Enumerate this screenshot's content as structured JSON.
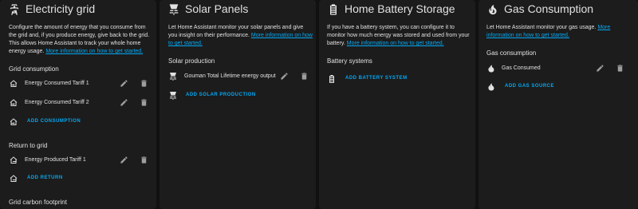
{
  "colors": {
    "accent": "#03a9f4",
    "card_bg": "#1c1c1c",
    "page_bg": "#111111",
    "text": "#e1e1e1"
  },
  "grid": {
    "title": "Electricity grid",
    "icon": "transmission-tower-icon",
    "desc": "Configure the amount of energy that you consume from the grid and, if you produce energy, give back to the grid. This allows Home Assistant to track your whole home energy usage.",
    "link": "More information on how to get started.",
    "consumption_title": "Grid consumption",
    "consumption": [
      {
        "label": "Energy Consumed Tariff 1"
      },
      {
        "label": "Energy Consumed Tariff 2"
      }
    ],
    "add_consumption": "ADD CONSUMPTION",
    "return_title": "Return to grid",
    "return": [
      {
        "label": "Energy Produced Tariff 1"
      }
    ],
    "add_return": "ADD RETURN",
    "carbon_title": "Grid carbon footprint"
  },
  "solar": {
    "title": "Solar Panels",
    "icon": "solar-power-icon",
    "desc": "Let Home Assistant monitor your solar panels and give you insight on their performance.",
    "link": "More information on how to get started.",
    "production_title": "Solar production",
    "items": [
      {
        "label": "Gouman Total Lifetime energy output"
      }
    ],
    "add_label": "ADD SOLAR PRODUCTION"
  },
  "battery": {
    "title": "Home Battery Storage",
    "icon": "battery-icon",
    "desc": "If you have a battery system, you can configure it to monitor how much energy was stored and used from your battery.",
    "link": "More information on how to get started.",
    "systems_title": "Battery systems",
    "add_label": "ADD BATTERY SYSTEM"
  },
  "gas": {
    "title": "Gas Consumption",
    "icon": "fire-icon",
    "desc": "Let Home Assistant monitor your gas usage.",
    "link": "More information on how to get started.",
    "consumption_title": "Gas consumption",
    "items": [
      {
        "label": "Gas Consumed"
      }
    ],
    "add_label": "ADD GAS SOURCE"
  }
}
